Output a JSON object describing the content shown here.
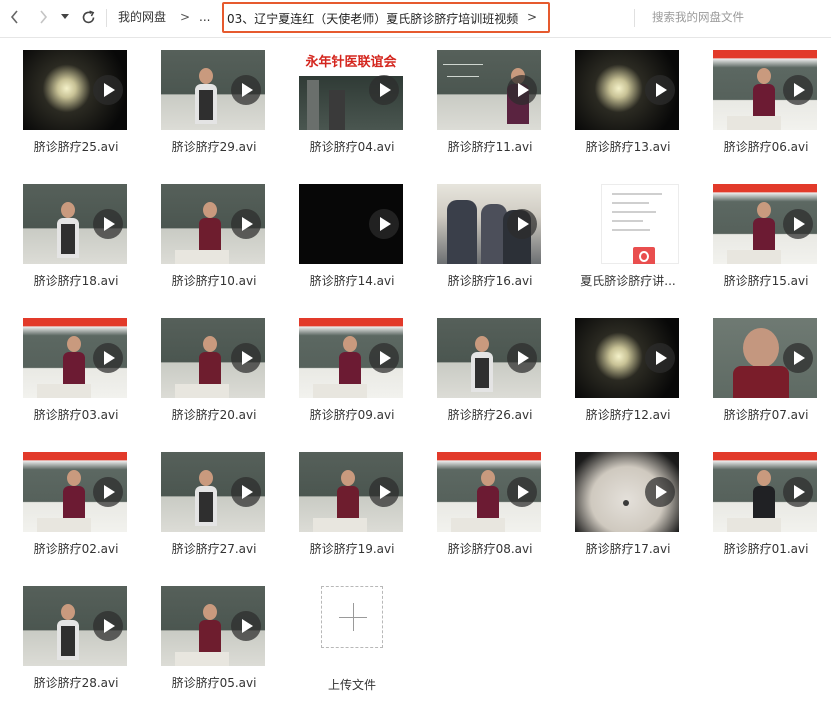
{
  "nav": {
    "back_icon": "chevron-left-icon",
    "forward_icon": "chevron-right-icon",
    "history_icon": "triangle-down-icon",
    "refresh_icon": "refresh-icon"
  },
  "breadcrumb": {
    "root": "我的网盘",
    "sep": ">",
    "ellipsis": "...",
    "current": "03、辽宁夏连红（天使老师）夏氏脐诊脐疗培训班视频",
    "current_arrow": ">"
  },
  "search": {
    "placeholder": "搜索我的网盘文件"
  },
  "colors": {
    "highlight_border": "#e65a2e",
    "pdf_badge": "#e94e4e"
  },
  "files": [
    {
      "name": "脐诊脐疗25.avi",
      "type": "video",
      "scene": "dark-light"
    },
    {
      "name": "脐诊脐疗29.avi",
      "type": "video",
      "scene": "woman-board"
    },
    {
      "name": "脐诊脐疗04.avi",
      "type": "video",
      "scene": "banner-room"
    },
    {
      "name": "脐诊脐疗11.avi",
      "type": "video",
      "scene": "chalkboard-man"
    },
    {
      "name": "脐诊脐疗13.avi",
      "type": "video",
      "scene": "dark-light"
    },
    {
      "name": "脐诊脐疗06.avi",
      "type": "video",
      "scene": "banner-woman"
    },
    {
      "name": "脐诊脐疗18.avi",
      "type": "video",
      "scene": "woman-board"
    },
    {
      "name": "脐诊脐疗10.avi",
      "type": "video",
      "scene": "chalkboard-woman"
    },
    {
      "name": "脐诊脐疗14.avi",
      "type": "video",
      "scene": "black"
    },
    {
      "name": "脐诊脐疗16.avi",
      "type": "video",
      "scene": "crowd"
    },
    {
      "name": "夏氏脐诊脐疗讲...",
      "type": "pdf",
      "scene": "pdf"
    },
    {
      "name": "脐诊脐疗15.avi",
      "type": "video",
      "scene": "banner-woman"
    },
    {
      "name": "脐诊脐疗03.avi",
      "type": "video",
      "scene": "banner-woman"
    },
    {
      "name": "脐诊脐疗20.avi",
      "type": "video",
      "scene": "chalkboard-woman"
    },
    {
      "name": "脐诊脐疗09.avi",
      "type": "video",
      "scene": "banner-woman"
    },
    {
      "name": "脐诊脐疗26.avi",
      "type": "video",
      "scene": "woman-board"
    },
    {
      "name": "脐诊脐疗12.avi",
      "type": "video",
      "scene": "dark-light"
    },
    {
      "name": "脐诊脐疗07.avi",
      "type": "video",
      "scene": "closeup"
    },
    {
      "name": "脐诊脐疗02.avi",
      "type": "video",
      "scene": "banner-woman"
    },
    {
      "name": "脐诊脐疗27.avi",
      "type": "video",
      "scene": "woman-board"
    },
    {
      "name": "脐诊脐疗19.avi",
      "type": "video",
      "scene": "chalkboard-woman"
    },
    {
      "name": "脐诊脐疗08.avi",
      "type": "video",
      "scene": "banner-woman"
    },
    {
      "name": "脐诊脐疗17.avi",
      "type": "video",
      "scene": "belly"
    },
    {
      "name": "脐诊脐疗01.avi",
      "type": "video",
      "scene": "banner-man"
    },
    {
      "name": "脐诊脐疗28.avi",
      "type": "video",
      "scene": "woman-board"
    },
    {
      "name": "脐诊脐疗05.avi",
      "type": "video",
      "scene": "chalkboard-woman"
    },
    {
      "name": "上传文件",
      "type": "upload",
      "scene": "upload"
    }
  ],
  "banner_text": "永年针医联谊会"
}
